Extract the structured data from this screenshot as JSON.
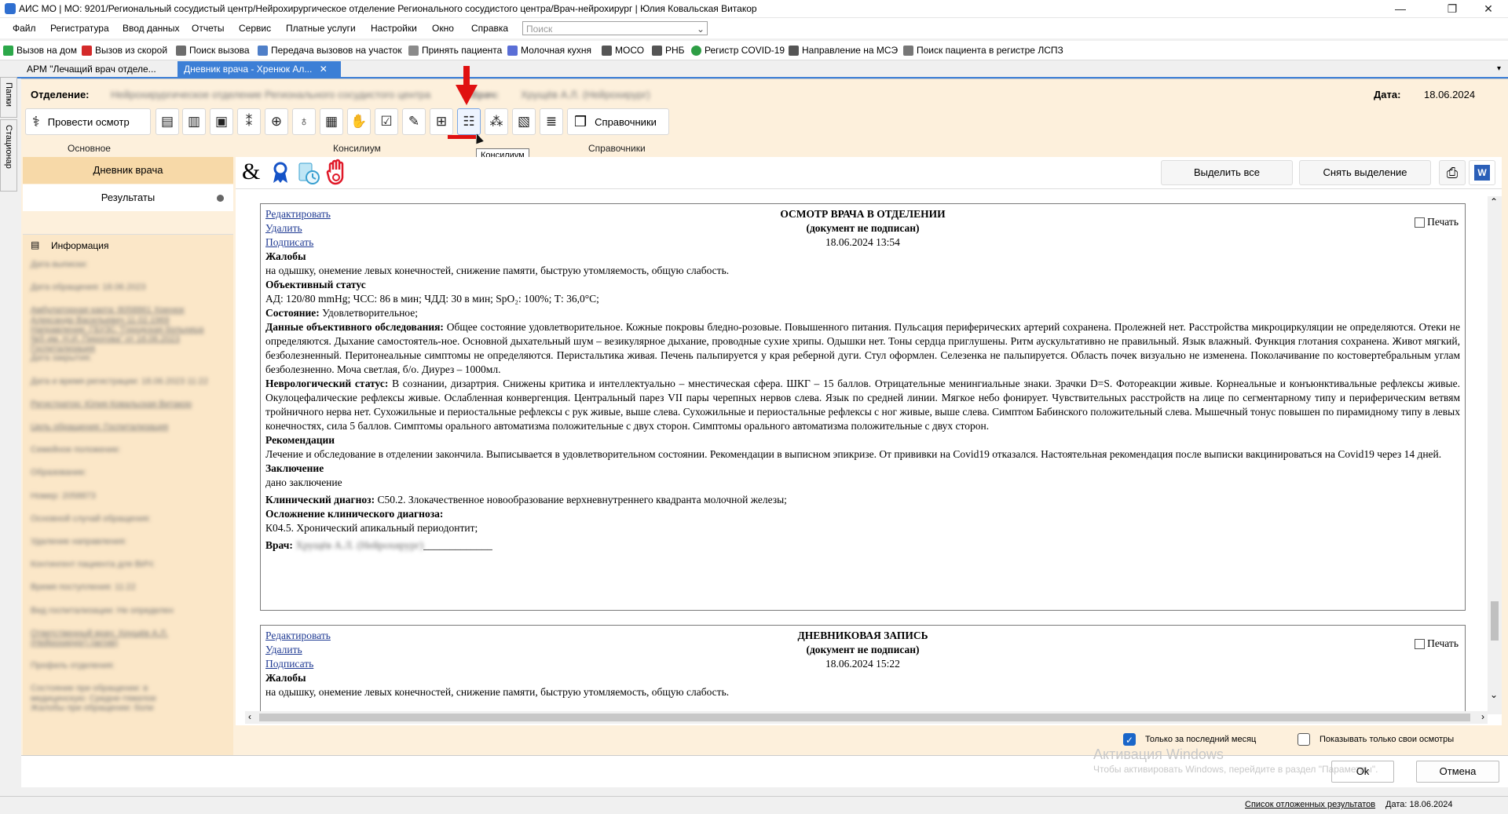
{
  "window": {
    "title": "АИС МО | МО: 9201/Региональный сосудистый центр/Нейрохирургическое отделение Регионального сосудистого центра/Врач-нейрохирург | Юлия Ковальская Витакор",
    "minimize": "—",
    "maximize": "❐",
    "close": "✕"
  },
  "menu": {
    "items": [
      "Файл",
      "Регистратура",
      "Ввод данных",
      "Отчеты",
      "Сервис",
      "Платные услуги",
      "Настройки",
      "Окно",
      "Справка"
    ],
    "search_placeholder": "Поиск"
  },
  "quickbar": {
    "items": [
      "Вызов на дом",
      "Вызов из скорой",
      "Поиск вызова",
      "Передача вызовов на участок",
      "Принять пациента",
      "Молочная кухня",
      "МОСО",
      "РНБ",
      "Регистр COVID-19",
      "Направление на МСЭ",
      "Поиск пациента в регистре ЛСПЗ"
    ]
  },
  "doc_tabs": {
    "tab1": "АРМ \"Лечащий врач отделе...",
    "tab2": "Дневник врача - Хренюк Ал...",
    "close": "✕"
  },
  "side_tabs": {
    "top": "Папки",
    "bottom": "Стационар"
  },
  "header": {
    "department_label": "Отделение:",
    "department_value": "Нейрохирургическое отделение Регионального сосудистого центра",
    "doctor_label": "Врач:",
    "doctor_value": "Хрущёв А.Л. (Нейрохирург)",
    "date_label": "Дата:",
    "date_value": "18.06.2024"
  },
  "ribbon": {
    "exam_button": "Провести осмотр",
    "reference_button": "Справочники",
    "group_basic": "Основное",
    "group_council": "Консилиум",
    "group_reference": "Справочники",
    "tooltip": "Консилиум"
  },
  "sidebar": {
    "diary": "Дневник врача",
    "results": "Результаты",
    "info_title": "Информация",
    "info_lines": [
      "Дата выписки: ",
      "Дата обращения: 18.06.2023",
      "Амбулаторная карта: 8058861 Хренюк",
      "Александр Васильевич 11.02.1969",
      "Направление: ГБУЗС \"Городская больница",
      "№5 им. Н.И. Пирогова\" от 18.06.2023",
      "Госпитализация",
      "Дата закрытия: ",
      "Дата и время регистрации: 18.06.2023 11:22",
      "Регистратор: Юлия Ковальская Витакор",
      "Цель обращения: Госпитализация",
      "Семейное положение: ",
      "Образование: ",
      "Номер: 2058873",
      "Основной случай обращения: ",
      "Удаление направления: ",
      "Контингент пациента для ВИЧ: ",
      "Время поступления: 11:22",
      "Вид госпитализации: Не определен",
      "Ответственный врач: Хрущёв А.Л.",
      "(Нейрохирург) (актив)",
      "Профиль отделения: ",
      "Состояние при обращении: в",
      "медицинскую: Средне-тяжелое",
      "Жалобы при обращении: боли"
    ]
  },
  "content": {
    "select_all": "Выделить все",
    "deselect": "Снять выделение"
  },
  "record1": {
    "edit": "Редактировать",
    "delete": "Удалить",
    "sign": "Подписать",
    "title": "ОСМОТР ВРАЧА В ОТДЕЛЕНИИ",
    "subtitle": "(документ не подписан)",
    "datetime": "18.06.2024 13:54",
    "print": "Печать",
    "complaints_title": "Жалобы",
    "complaints": "на одышку, онемение левых конечностей, снижение памяти, быструю утомляемость, общую слабость.",
    "objective_title": "Объективный статус",
    "vitals": "АД: 120/80 mmHg; ЧСС: 86 в мин; ЧДД: 30 в мин; SpO₂: 100%; Т: 36,0°С;",
    "state_label": "Состояние:",
    "state": "Удовлетворительное;",
    "exam_label": "Данные объективного обследования:",
    "exam": "Общее состояние удовлетворительное. Кожные покровы бледно-розовые. Повышенного питания. Пульсация периферических артерий сохранена. Пролежней нет. Расстройства микроциркуляции не определяются. Отеки не определяются. Дыхание самостоятель-ное. Основной дыхательный шум – везикулярное дыхание, проводные сухие хрипы. Одышки нет. Тоны сердца приглушены. Ритм аускультативно не правильный. Язык влажный. Функция глотания сохранена. Живот мягкий, безболезненный. Перитонеальные симптомы не определяются. Перистальтика живая. Печень пальпируется у края реберной дуги. Стул оформлен. Селезенка не пальпируется. Область почек визуально не изменена. Поколачивание по костовертебральным углам безболезненно. Моча светлая, б/о. Диурез – 1000мл.",
    "neuro_label": "Неврологический статус:",
    "neuro": "В сознании, дизартрия. Снижены критика и интеллектуально – мнестическая сфера. ШКГ – 15 баллов. Отрицательные менингиальные знаки. Зрачки D=S. Фотореакции живые. Корнеальные и конъюнктивальные рефлексы живые. Окулоцефалические рефлексы живые. Ослабленная конвергенция. Центральный парез VII пары черепных нервов слева. Язык по средней линии. Мягкое небо фонирует. Чувствительных расстройств на лице по сегментарному типу и периферическим ветвям тройничного нерва нет. Сухожильные и периостальные рефлексы с рук живые, выше слева. Сухожильные и периостальные рефлексы с ног живые, выше слева. Симптом Бабинского положительный слева. Мышечный тонус повышен по пирамидному типу в левых конечностях, сила 5 баллов. Симптомы орального автоматизма положительные с двух сторон. Симптомы орального автоматизма положительные с двух сторон.",
    "rec_title": "Рекомендации",
    "rec": "Лечение и обследование в отделении закончила. Выписывается в удовлетворительном состоянии. Рекомендации в выписном эпикризе. От прививки на Covid19 отказался. Настоятельная рекомендация после выписки вакцинироваться на Covid19 через 14 дней.",
    "concl_title": "Заключение",
    "concl": "дано заключение",
    "diag_label": "Клинический диагноз:",
    "diag": "C50.2. Злокачественное новообразование верхневнутреннего квадранта молочной железы;",
    "comp_label": "Осложнение клинического диагноза:",
    "comp": "К04.5. Хронический апикальный периодонтит;",
    "doctor_label": "Врач:",
    "doctor": "Хрущёв А.Л. (Нейрохирург)",
    "sign_line": "_____________"
  },
  "record2": {
    "edit": "Редактировать",
    "delete": "Удалить",
    "sign": "Подписать",
    "title": "ДНЕВНИКОВАЯ ЗАПИСЬ",
    "subtitle": "(документ не подписан)",
    "datetime": "18.06.2024 15:22",
    "print": "Печать",
    "complaints_title": "Жалобы",
    "complaints": "на одышку, онемение левых конечностей, снижение памяти, быструю утомляемость, общую слабость."
  },
  "bottom": {
    "last_month": "Только за последний месяц",
    "only_mine": "Показывать только свои осмотры",
    "watermark1": "Активация Windows",
    "watermark2": "Чтобы активировать Windows, перейдите в раздел \"Параметры\".",
    "ok": "Ok",
    "cancel": "Отмена"
  },
  "status": {
    "deferred": "Список отложенных результатов",
    "date": "Дата: 18.06.2024"
  },
  "colors": {
    "accent": "#3c7fd6",
    "panel": "#fdf0dc",
    "arrow": "#e01010",
    "link": "#1f3a93"
  }
}
